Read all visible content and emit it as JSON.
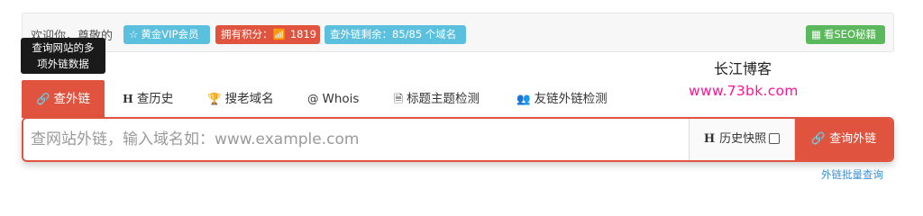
{
  "topbar": {
    "welcome": "欢迎你，尊敬的",
    "vip_badge": "黄金VIP会员",
    "points_label": "拥有积分：",
    "points_value": "1819",
    "remaining": "查外链剩余：85/85 个域名",
    "seo_button": "看SEO秘籍"
  },
  "tooltip": {
    "line1": "查询网站的多",
    "line2": "项外链数据"
  },
  "brand": {
    "name": "长江博客",
    "url": "www.73bk.com"
  },
  "tabs": [
    {
      "icon": "link-icon",
      "label": "查外链",
      "active": true
    },
    {
      "icon": "h-icon",
      "label": "查历史"
    },
    {
      "icon": "trophy-icon",
      "label": "搜老域名"
    },
    {
      "icon": "at-icon",
      "label": "Whois"
    },
    {
      "icon": "document-icon",
      "label": "标题主题检测"
    },
    {
      "icon": "people-icon",
      "label": "友链外链检测"
    }
  ],
  "search": {
    "placeholder": "查网站外链，输入域名如：www.example.com",
    "value": "",
    "history_label": "历史快照",
    "history_checked": false,
    "query_button": "查询外链"
  },
  "batch_link": "外链批量查询",
  "colors": {
    "accent": "#e0533e",
    "info": "#5bc0de",
    "success": "#5cb85c",
    "brand_url": "#ff1493"
  }
}
